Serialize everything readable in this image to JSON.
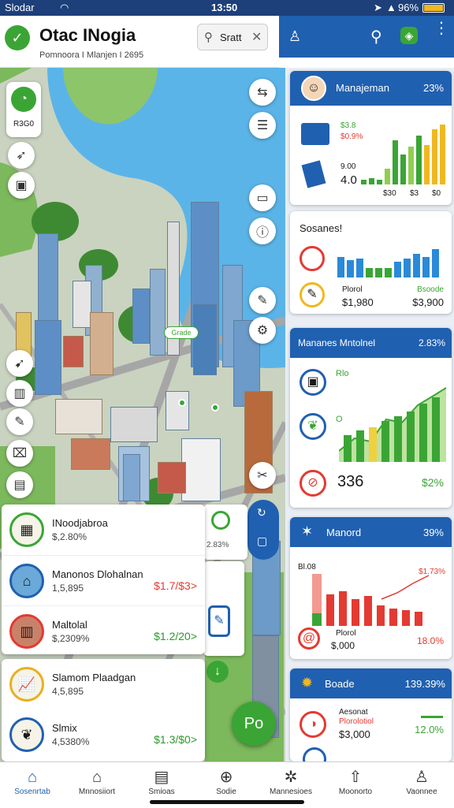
{
  "status": {
    "carrier": "Slodar",
    "time": "13:50",
    "battery": "96%"
  },
  "header": {
    "title": "Otac INogia",
    "subtitle": "Pomnoora I Mlanjen I 2695",
    "search_value": "Sratt"
  },
  "map": {
    "pin_label": "Grade"
  },
  "left_badge": "R3G0",
  "list": [
    {
      "title": "INoodjabroa",
      "value": "$,2.80%",
      "change": ""
    },
    {
      "title": "Manonos Dlohalnan",
      "value": "1,5,895",
      "change": "$1.7/$3>"
    },
    {
      "title": "Maltolal",
      "value": "$,2309%",
      "change": "$1.2/20>"
    }
  ],
  "list2": [
    {
      "title": "Slamom Plaadgan",
      "value": "4,5,895",
      "change": ""
    },
    {
      "title": "Slmix",
      "value": "4,5380%",
      "change": "$1.3/$0>"
    }
  ],
  "behind_card_text": "2.83%",
  "map_fab_label": "Po",
  "cards": [
    {
      "title": "Manajeman",
      "pct": "23%",
      "label1": "$3.8",
      "label2": "$0.9%",
      "label3": "9.00",
      "value": "4.0",
      "axis": [
        "$30",
        "$3",
        "$0"
      ]
    },
    {
      "title": "Sosanes!",
      "left": "Plorol",
      "left_val": "$1,980",
      "right": "Bsoode",
      "right_val": "$3,900"
    },
    {
      "title": "Mananes Mntolnel",
      "pct": "2.83%",
      "label1": "Rlo",
      "label2": "O",
      "value": "336",
      "pct2": "$2%"
    },
    {
      "title": "Manord",
      "pct": "39%",
      "label1": "Bl.08",
      "label2": "$1.73%",
      "label3": "Plorol",
      "value": "$,000",
      "pct2": "18.0%"
    },
    {
      "title": "Boade",
      "pct": "139.39%",
      "label1": "Aesonat",
      "label2": "Plorolotiol",
      "value": "$3,000",
      "pct2": "12.0%"
    }
  ],
  "nav": [
    "Sosenrtab",
    "Mnnosiiort",
    "Smioas",
    "Sodie",
    "Mannesioes",
    "Moonorto",
    "Vaonnee"
  ],
  "colors": {
    "blue": "#2060b0",
    "green": "#3aa535",
    "yellow": "#f0b820",
    "red": "#e43a32"
  }
}
